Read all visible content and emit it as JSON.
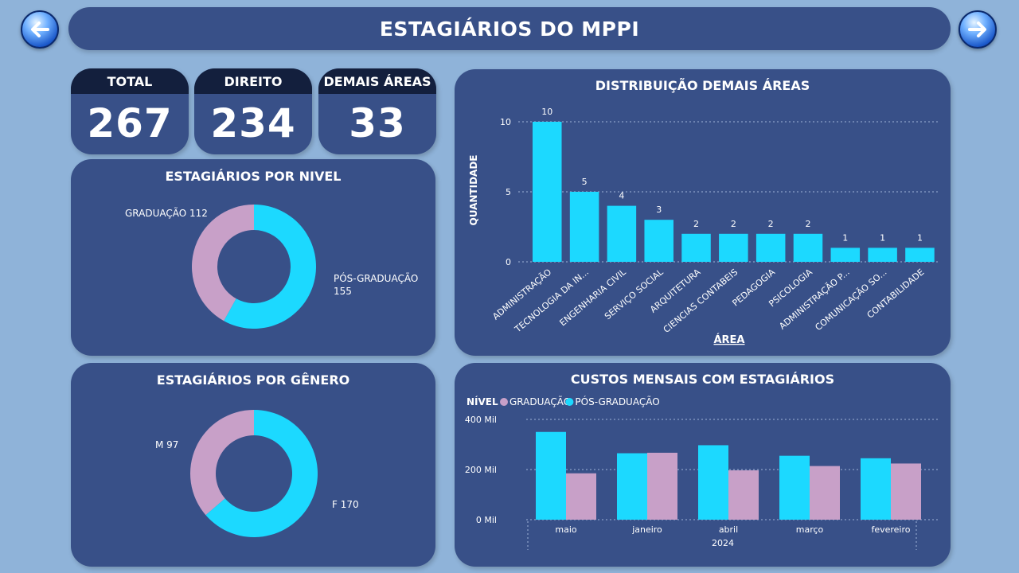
{
  "header": {
    "title": "ESTAGIÁRIOS DO MPPI"
  },
  "nav": {
    "back_icon": "arrow-left-icon",
    "next_icon": "arrow-right-icon"
  },
  "kpis": [
    {
      "label": "TOTAL",
      "value": "267"
    },
    {
      "label": "DIREITO",
      "value": "234"
    },
    {
      "label": "DEMAIS ÁREAS",
      "value": "33"
    }
  ],
  "colors": {
    "background": "#8fb3d9",
    "card": "#385088",
    "header_band": "#131f3d",
    "cyan": "#1cd9ff",
    "pink": "#c8a0c8"
  },
  "chart_data": [
    {
      "type": "pie",
      "title": "ESTAGIÁRIOS POR NIVEL",
      "donut": true,
      "slices": [
        {
          "label": "GRADUAÇÃO",
          "value": 112,
          "color": "#c8a0c8"
        },
        {
          "label": "PÓS-GRADUAÇÃO",
          "value": 155,
          "color": "#1cd9ff"
        }
      ]
    },
    {
      "type": "pie",
      "title": "ESTAGIÁRIOS POR GÊNERO",
      "donut": true,
      "slices": [
        {
          "label": "M",
          "value": 97,
          "color": "#c8a0c8"
        },
        {
          "label": "F",
          "value": 170,
          "color": "#1cd9ff"
        }
      ]
    },
    {
      "type": "bar",
      "title": "DISTRIBUIÇÃO DEMAIS ÁREAS",
      "xlabel": "ÁREA",
      "ylabel": "QUANTIDADE",
      "ylim": [
        0,
        10
      ],
      "yticks": [
        0,
        5,
        10
      ],
      "grid": true,
      "color": "#1cd9ff",
      "categories": [
        "ADMINISTRAÇÃO",
        "TECNOLOGIA DA IN...",
        "ENGENHARIA CIVIL",
        "SERVIÇO SOCIAL",
        "ARQUITETURA",
        "CIENCIAS CONTABEIS",
        "PEDAGOGIA",
        "PSICOLOGIA",
        "ADMINISTRAÇÃO P...",
        "COMUNICAÇÃO SO...",
        "CONTABILIDADE"
      ],
      "values": [
        10,
        5,
        4,
        3,
        2,
        2,
        2,
        2,
        1,
        1,
        1
      ]
    },
    {
      "type": "bar",
      "title": "CUSTOS MENSAIS COM ESTAGIÁRIOS",
      "legend_title": "NÍVEL",
      "legend_position": "top-left",
      "grid": true,
      "ylim": [
        0,
        400000
      ],
      "yticks": [
        0,
        200000,
        400000
      ],
      "ytick_labels": [
        "0 Mil",
        "200 Mil",
        "400 Mil"
      ],
      "categories": [
        "maio",
        "janeiro",
        "abril",
        "março",
        "fevereiro"
      ],
      "x_group_label": "2024",
      "series": [
        {
          "name": "PÓS-GRADUAÇÃO",
          "color": "#1cd9ff",
          "values": [
            350000,
            265000,
            297000,
            255000,
            245000
          ]
        },
        {
          "name": "GRADUAÇÃO",
          "color": "#c8a0c8",
          "values": [
            185000,
            267000,
            197000,
            214000,
            224000
          ]
        }
      ]
    }
  ]
}
